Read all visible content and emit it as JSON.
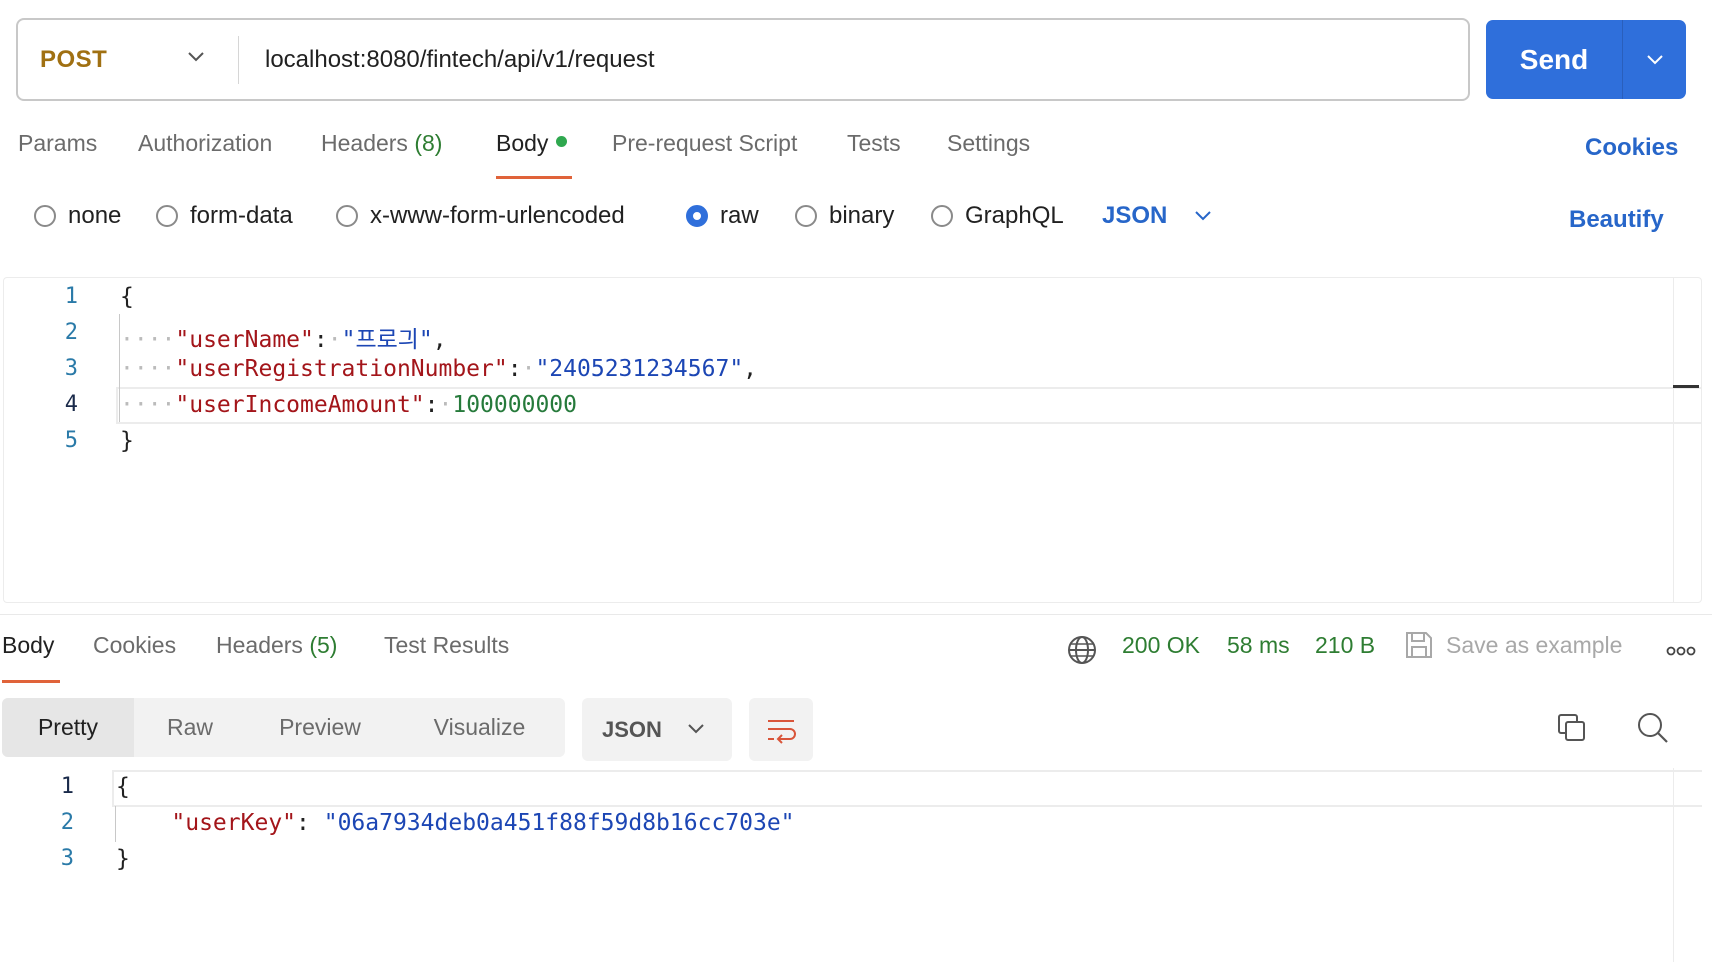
{
  "request": {
    "method": "POST",
    "url": "localhost:8080/fintech/api/v1/request",
    "send_label": "Send"
  },
  "request_tabs": {
    "params": "Params",
    "authorization": "Authorization",
    "headers": "Headers",
    "headers_count": "(8)",
    "body": "Body",
    "prerequest": "Pre-request Script",
    "tests": "Tests",
    "settings": "Settings",
    "cookies": "Cookies",
    "active": "Body"
  },
  "body_types": {
    "none": "none",
    "form_data": "form-data",
    "urlencoded": "x-www-form-urlencoded",
    "raw": "raw",
    "binary": "binary",
    "graphql": "GraphQL",
    "selected": "raw",
    "language": "JSON",
    "beautify": "Beautify"
  },
  "request_body": {
    "line_numbers": [
      "1",
      "2",
      "3",
      "4",
      "5"
    ],
    "open_brace": "{",
    "close_brace": "}",
    "fields": [
      {
        "key": "\"userName\"",
        "value": "\"프로긔\"",
        "trail": ","
      },
      {
        "key": "\"userRegistrationNumber\"",
        "value": "\"2405231234567\"",
        "trail": ","
      },
      {
        "key": "\"userIncomeAmount\"",
        "value": "100000000",
        "trail": ""
      }
    ],
    "active_line": 4
  },
  "response_tabs": {
    "body": "Body",
    "cookies": "Cookies",
    "headers": "Headers",
    "headers_count": "(5)",
    "test_results": "Test Results",
    "active": "Body"
  },
  "response_meta": {
    "status": "200 OK",
    "time": "58 ms",
    "size": "210 B",
    "save_example": "Save as example"
  },
  "response_view": {
    "pretty": "Pretty",
    "raw": "Raw",
    "preview": "Preview",
    "visualize": "Visualize",
    "format": "JSON",
    "selected": "Pretty"
  },
  "response_body": {
    "line_numbers": [
      "1",
      "2",
      "3"
    ],
    "open_brace": "{",
    "close_brace": "}",
    "key": "\"userKey\"",
    "value": "\"06a7934deb0a451f88f59d8b16cc703e\""
  },
  "colors": {
    "accent": "#2f6fdb",
    "method": "#a07012",
    "status_ok": "#2e7d32",
    "tab_underline": "#e0633a",
    "json_key": "#a3151a",
    "json_string": "#1c46b4",
    "json_number": "#267a3b"
  }
}
